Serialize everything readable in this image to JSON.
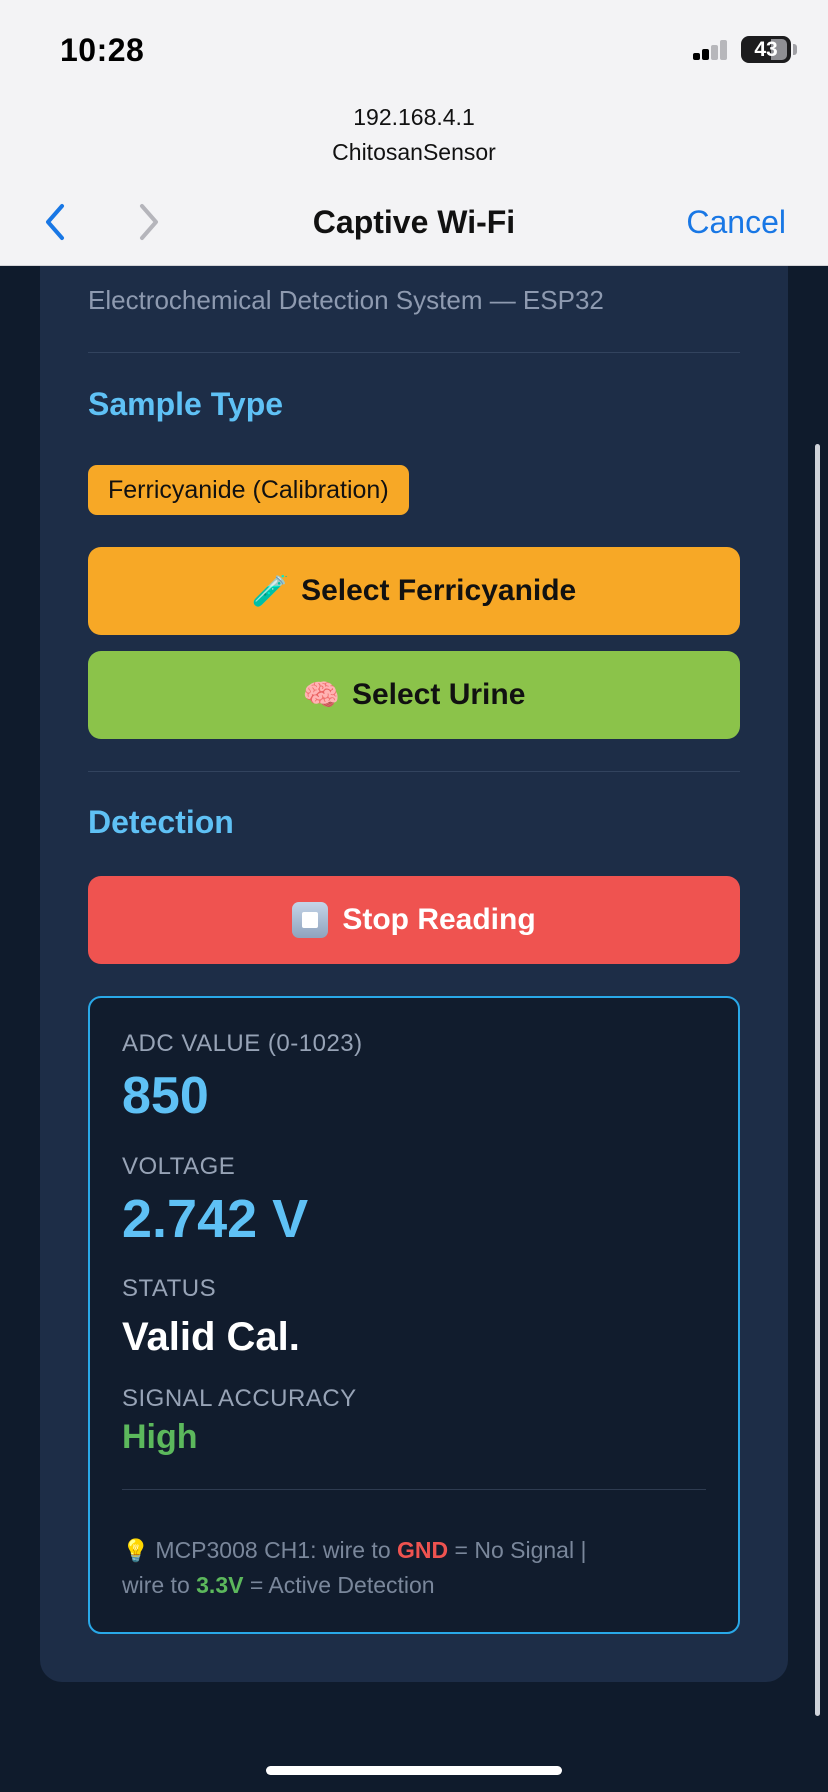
{
  "status_bar": {
    "time": "10:28",
    "battery": "43"
  },
  "browser": {
    "ip": "192.168.4.1",
    "network": "ChitosanSensor",
    "title": "Captive Wi-Fi",
    "cancel_label": "Cancel"
  },
  "page": {
    "subtitle": "Electrochemical Detection System — ESP32",
    "sample_section_title": "Sample Type",
    "current_sample": "Ferricyanide (Calibration)",
    "buttons": {
      "ferricyanide_icon": "🧪",
      "ferricyanide_label": "Select Ferricyanide",
      "urine_icon": "🧠",
      "urine_label": "Select Urine",
      "stop_label": "Stop Reading"
    },
    "detection_section_title": "Detection",
    "readings": {
      "adc_label": "ADC VALUE (0-1023)",
      "adc_value": "850",
      "voltage_label": "VOLTAGE",
      "voltage_value": "2.742 V",
      "status_label": "STATUS",
      "status_value": "Valid Cal.",
      "accuracy_label": "SIGNAL ACCURACY",
      "accuracy_value": "High"
    },
    "hint": {
      "icon": "💡",
      "part1": "MCP3008 CH1: wire to ",
      "gnd": "GND",
      "part2": " = No Signal  |",
      "part3": "wire to ",
      "v33": "3.3V",
      "part4": " = Active Detection"
    }
  },
  "colors": {
    "accent_blue": "#5fc1f5",
    "ferricyanide": "#f7a826",
    "urine": "#8bc34a",
    "stop": "#ef5350",
    "link_blue": "#1877e5"
  }
}
